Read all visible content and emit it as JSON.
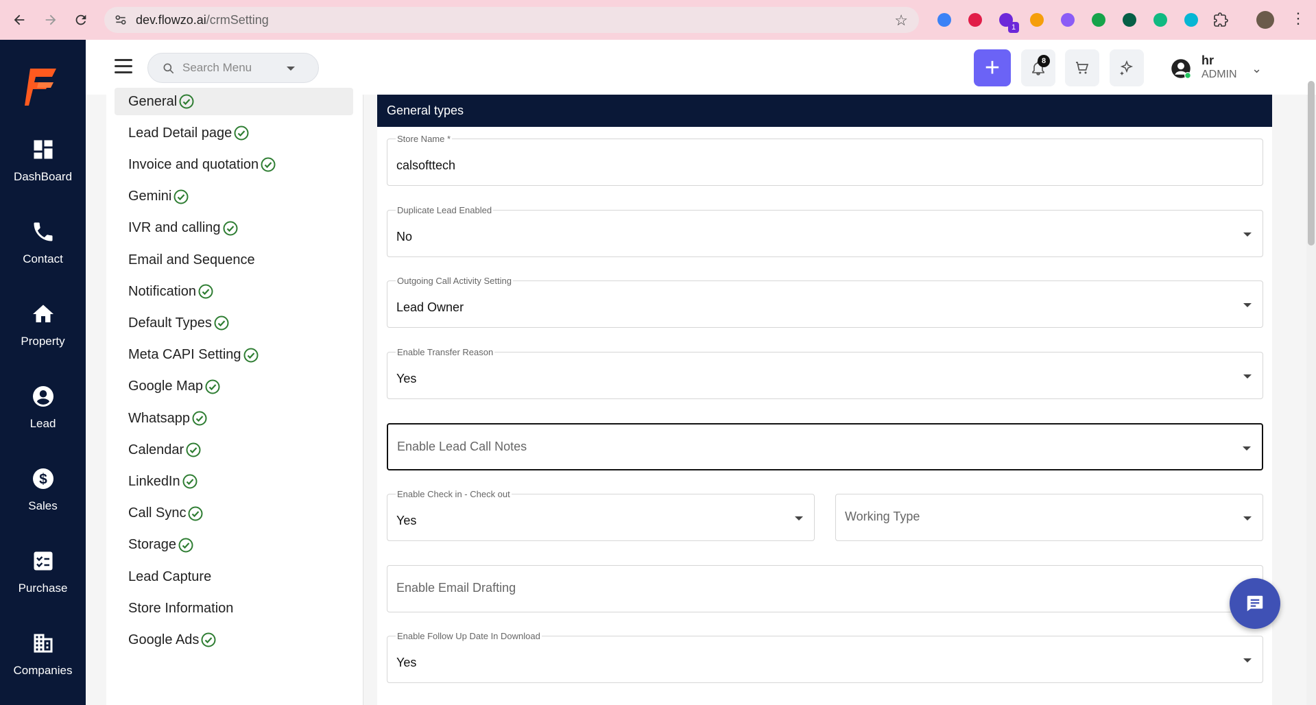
{
  "browser": {
    "url_host": "dev.flowzo.ai",
    "url_path": "/crmSetting",
    "extensions": [
      {
        "name": "ext-1-icon",
        "color": "#3b82f6"
      },
      {
        "name": "ext-2-icon",
        "color": "#e11d48"
      },
      {
        "name": "ext-3-icon",
        "color": "#6d28d9"
      },
      {
        "name": "ext-4-icon",
        "color": "#f59e0b"
      },
      {
        "name": "ext-5-icon",
        "color": "#8b5cf6"
      },
      {
        "name": "ext-6-icon",
        "color": "#16a34a"
      },
      {
        "name": "ext-7-icon",
        "color": "#065f46"
      },
      {
        "name": "ext-8-icon",
        "color": "#10b981"
      },
      {
        "name": "ext-9-icon",
        "color": "#06b6d4"
      }
    ],
    "ext_badge": "1"
  },
  "rail": {
    "items": [
      {
        "label": "DashBoard",
        "icon": "dashboard-icon"
      },
      {
        "label": "Contact",
        "icon": "phone-icon"
      },
      {
        "label": "Property",
        "icon": "home-icon"
      },
      {
        "label": "Lead",
        "icon": "user-circle-icon"
      },
      {
        "label": "Sales",
        "icon": "dollar-icon"
      },
      {
        "label": "Purchase",
        "icon": "checklist-icon"
      },
      {
        "label": "Companies",
        "icon": "building-icon"
      }
    ]
  },
  "header": {
    "search_placeholder": "Search Menu",
    "add_label": "+",
    "notification_count": "8",
    "user_name": "hr",
    "user_role": "ADMIN"
  },
  "settings_menu": {
    "items": [
      {
        "label": "General",
        "checked": true
      },
      {
        "label": "Lead Detail page",
        "checked": true
      },
      {
        "label": "Invoice and quotation",
        "checked": true
      },
      {
        "label": "Gemini",
        "checked": true
      },
      {
        "label": "IVR and calling",
        "checked": true
      },
      {
        "label": "Email and Sequence",
        "checked": false
      },
      {
        "label": "Notification",
        "checked": true
      },
      {
        "label": "Default Types",
        "checked": true
      },
      {
        "label": "Meta CAPI Setting",
        "checked": true
      },
      {
        "label": "Google Map",
        "checked": true
      },
      {
        "label": "Whatsapp",
        "checked": true
      },
      {
        "label": "Calendar",
        "checked": true
      },
      {
        "label": "LinkedIn",
        "checked": true
      },
      {
        "label": "Call Sync",
        "checked": true
      },
      {
        "label": "Storage",
        "checked": true
      },
      {
        "label": "Lead Capture",
        "checked": false
      },
      {
        "label": "Store Information",
        "checked": false
      },
      {
        "label": "Google Ads",
        "checked": true
      }
    ]
  },
  "panel": {
    "title": "General types",
    "fields": {
      "store_name": {
        "label": "Store Name *",
        "value": "calsofttech"
      },
      "duplicate_lead": {
        "label": "Duplicate Lead Enabled",
        "value": "No"
      },
      "outgoing_call": {
        "label": "Outgoing Call Activity Setting",
        "value": "Lead Owner"
      },
      "transfer_reason": {
        "label": "Enable Transfer Reason",
        "value": "Yes"
      },
      "lead_call_notes": {
        "placeholder": "Enable Lead Call Notes"
      },
      "check_in_out": {
        "label": "Enable Check in - Check out",
        "value": "Yes"
      },
      "working_type": {
        "placeholder": "Working Type"
      },
      "email_drafting": {
        "placeholder": "Enable Email Drafting"
      },
      "follow_up_date": {
        "label": "Enable Follow Up Date In Download",
        "value": "Yes"
      }
    }
  },
  "colors": {
    "sidebar_bg": "#0a1837",
    "accent": "#6b63f6",
    "check_green": "#2e7d32",
    "chat_fab": "#3f51b5"
  }
}
